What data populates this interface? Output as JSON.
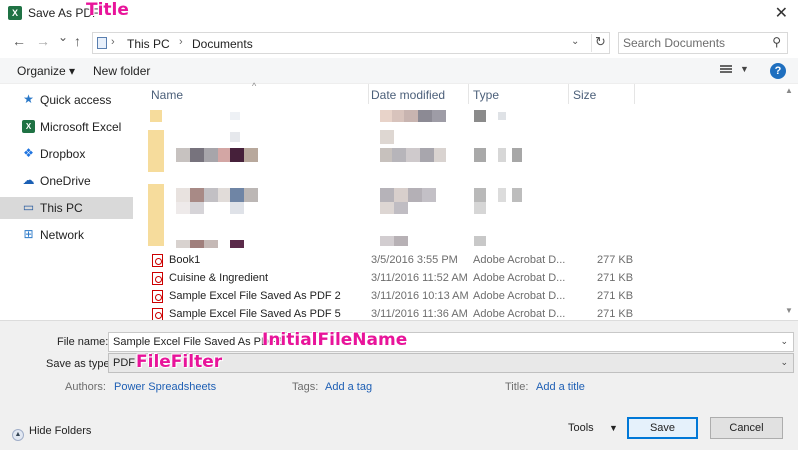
{
  "window": {
    "title": "Save As PDF",
    "app_icon": "excel-icon",
    "close_glyph": "✕"
  },
  "annotations": {
    "title": "Title",
    "initial_file_name": "InitialFileName",
    "file_filter": "FileFilter"
  },
  "nav": {
    "back": "←",
    "forward": "→",
    "recent": "⌄",
    "up": "↑",
    "breadcrumb": [
      "This PC",
      "Documents"
    ],
    "search_placeholder": "Search Documents"
  },
  "toolbar": {
    "organize": "Organize ▾",
    "new_folder": "New folder",
    "help": "?"
  },
  "sidebar": {
    "items": [
      {
        "label": "Quick access",
        "icon": "star-icon"
      },
      {
        "label": "Microsoft Excel",
        "icon": "excel-icon"
      },
      {
        "label": "Dropbox",
        "icon": "dropbox-icon"
      },
      {
        "label": "OneDrive",
        "icon": "cloud-icon"
      },
      {
        "label": "This PC",
        "icon": "computer-icon",
        "selected": true
      },
      {
        "label": "Network",
        "icon": "network-icon"
      }
    ]
  },
  "file_list": {
    "columns": [
      "Name",
      "Date modified",
      "Type",
      "Size"
    ],
    "rows": [
      {
        "name": "Book1",
        "date": "3/5/2016 3:55 PM",
        "type": "Adobe Acrobat D...",
        "size": "277 KB"
      },
      {
        "name": "Cuisine & Ingredient",
        "date": "3/11/2016 11:52 AM",
        "type": "Adobe Acrobat D...",
        "size": "271 KB"
      },
      {
        "name": "Sample Excel File Saved As PDF 2",
        "date": "3/11/2016 10:13 AM",
        "type": "Adobe Acrobat D...",
        "size": "271 KB"
      },
      {
        "name": "Sample Excel File Saved As PDF 5",
        "date": "3/11/2016 11:36 AM",
        "type": "Adobe Acrobat D...",
        "size": "271 KB"
      }
    ]
  },
  "form": {
    "file_name_label": "File name:",
    "file_name_value": "Sample Excel File Saved As PDF 5",
    "save_as_type_label": "Save as type:",
    "save_as_type_value": "PDF",
    "authors_label": "Authors:",
    "authors_value": "Power Spreadsheets",
    "tags_label": "Tags:",
    "tags_value": "Add a tag",
    "title_label": "Title:",
    "title_value": "Add a title"
  },
  "footer": {
    "hide_folders": "Hide Folders",
    "tools": "Tools",
    "save": "Save",
    "cancel": "Cancel"
  }
}
